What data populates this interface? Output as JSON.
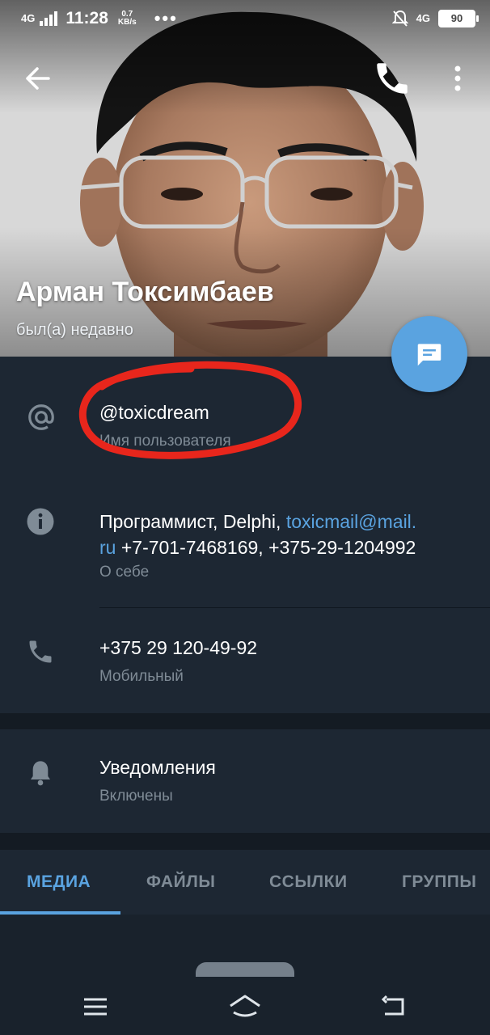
{
  "status_bar": {
    "network": "4G",
    "time": "11:28",
    "speed_value": "0.7",
    "speed_unit": "KB/s",
    "dots": "•••",
    "network_right": "4G",
    "battery": "90"
  },
  "profile": {
    "name": "Арман Токсимбаев",
    "last_seen": "был(а) недавно"
  },
  "info": {
    "username": "@toxicdream",
    "username_label": "Имя пользователя",
    "bio_text_1": "Программист, Delphi, ",
    "bio_email_1": "toxicmail@mail.",
    "bio_email_2": "ru",
    "bio_text_2": " +7-701-7468169, +375-29-1204992",
    "bio_label": "О себе",
    "phone": "+375 29 120-49-92",
    "phone_label": "Мобильный"
  },
  "notifications": {
    "title": "Уведомления",
    "status": "Включены"
  },
  "tabs": [
    {
      "label": "МЕДИА",
      "active": true
    },
    {
      "label": "ФАЙЛЫ",
      "active": false
    },
    {
      "label": "ССЫЛКИ",
      "active": false
    },
    {
      "label": "ГРУППЫ",
      "active": false
    }
  ],
  "colors": {
    "accent": "#5aa3e0",
    "background": "#1d2733",
    "secondary_text": "#7f8b96",
    "annotation_circle": "#e8261c"
  },
  "icons": {
    "back": "arrow-left-icon",
    "call": "phone-icon",
    "more": "more-vertical-icon",
    "fab": "message-icon",
    "username": "at-sign-icon",
    "bio": "info-icon",
    "phone": "phone-icon",
    "notifications": "bell-icon",
    "nav_menu": "menu-icon",
    "nav_home": "home-icon",
    "nav_back": "back-icon"
  }
}
